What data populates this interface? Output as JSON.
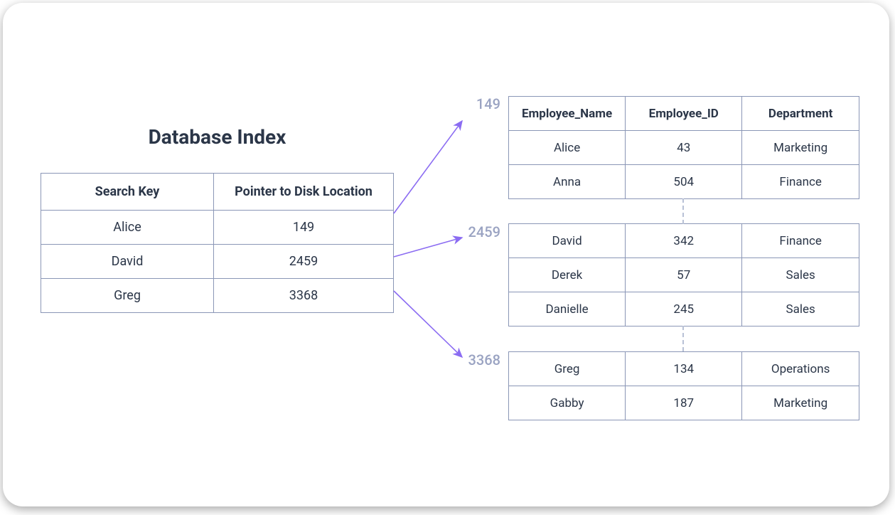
{
  "title": "Database Index",
  "indexTable": {
    "headers": {
      "key": "Search Key",
      "ptr": "Pointer to Disk Location"
    },
    "rows": [
      {
        "key": "Alice",
        "ptr": "149"
      },
      {
        "key": "David",
        "ptr": "2459"
      },
      {
        "key": "Greg",
        "ptr": "3368"
      }
    ]
  },
  "dataTable": {
    "headers": {
      "c1": "Employee_Name",
      "c2": "Employee_ID",
      "c3": "Department"
    }
  },
  "blocks": [
    {
      "label": "149",
      "rows": [
        {
          "name": "Alice",
          "id": "43",
          "dept": "Marketing"
        },
        {
          "name": "Anna",
          "id": "504",
          "dept": "Finance"
        }
      ]
    },
    {
      "label": "2459",
      "rows": [
        {
          "name": "David",
          "id": "342",
          "dept": "Finance"
        },
        {
          "name": "Derek",
          "id": "57",
          "dept": "Sales"
        },
        {
          "name": "Danielle",
          "id": "245",
          "dept": "Sales"
        }
      ]
    },
    {
      "label": "3368",
      "rows": [
        {
          "name": "Greg",
          "id": "134",
          "dept": "Operations"
        },
        {
          "name": "Gabby",
          "id": "187",
          "dept": "Marketing"
        }
      ]
    }
  ],
  "colors": {
    "arrow": "#8b6cf2"
  }
}
